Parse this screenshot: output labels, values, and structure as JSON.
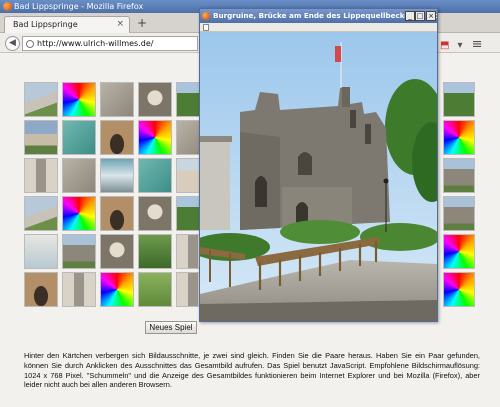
{
  "window": {
    "title": "Bad Lippspringe - Mozilla Firefox"
  },
  "tab": {
    "label": "Bad Lippspringe",
    "close": "×",
    "new_tab": "+"
  },
  "nav": {
    "back": "◀",
    "url": "http://www.ulrich-willmes.de/",
    "icons": [
      "pdf-icon",
      "menu-icon"
    ],
    "menu_glyph": "≡",
    "pdf_glyph": "⬒",
    "dropdown_glyph": "▾"
  },
  "game": {
    "new_game_label": "Neues Spiel",
    "description": "Hinter den Kärtchen verbergen sich Bildausschnitte, je zwei sind gleich. Finden Sie die Paare heraus. Haben Sie ein Paar gefunden, können Sie durch Anklicken des Ausschnittes das Gesamtbild aufrufen. Das Spiel benutzt JavaScript. Empfohlene Bildschirmauflösung: 1024 x 768 Pixel. \"Schummeln\" und die Anzeige des Gesamtbildes funktionieren beim Internet Explorer und bei Mozilla (Firefox), aber leider nicht auch bei allen anderen Browsern.",
    "tiles_left": [
      [
        "photo-person",
        "color-wheel",
        "photo-stone",
        "photo-statue",
        "photo-tree"
      ],
      [
        "photo-people",
        "photo-water",
        "photo-arch",
        "color-wheel",
        "photo-stone"
      ],
      [
        "photo-column",
        "photo-stone",
        "photo-fountain",
        "photo-water",
        "photo-building"
      ],
      [
        "photo-person",
        "color-wheel",
        "photo-arch",
        "photo-statue",
        "photo-tree"
      ],
      [
        "photo-window",
        "photo-ruins",
        "photo-statue",
        "photo-trees",
        "photo-column"
      ],
      [
        "photo-arch",
        "photo-column",
        "color-wheel",
        "photo-grass",
        "photo-column"
      ]
    ],
    "tiles_right": [
      "photo-tree",
      "color-wheel",
      "photo-ruins",
      "photo-ruins",
      "color-wheel",
      "color-wheel"
    ]
  },
  "popup": {
    "title": "Burgruine, Brücke am Ende des Lippequellbeckens - Mozill...",
    "minimize": "_",
    "maximize": "□",
    "close": "×"
  },
  "colors": {
    "titlebar": "#4c6fa8",
    "sky": "#b9d7ef",
    "stone": "#7a756c"
  }
}
